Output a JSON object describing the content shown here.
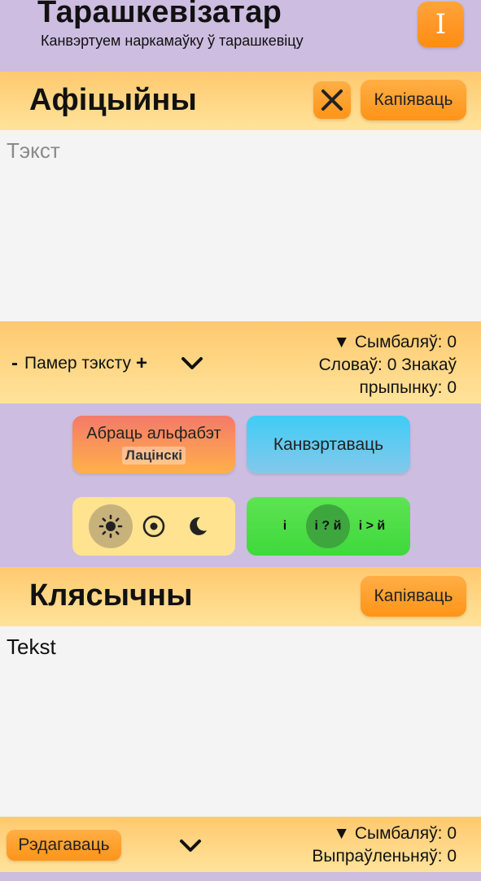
{
  "header": {
    "title": "Тарашкевізатар",
    "subtitle": "Канвэртуем наркамаўку ў тарашкевіцу",
    "info_label": "I"
  },
  "input_section": {
    "title": "Афіцыйны",
    "clear_icon": "close-icon",
    "copy_label": "Капіяваць",
    "text": "Тэкст",
    "font_size_minus": "-",
    "font_size_label": "Памер тэксту",
    "font_size_plus": "+",
    "expand_icon": "chevron-down-icon",
    "stats": {
      "symbols": "▼ Сымбаляў: 0",
      "words_punct_1": "Словаў: 0 Знакаў",
      "words_punct_2": "прыпынку: 0"
    }
  },
  "controls": {
    "alphabet_label": "Абраць альфабэт",
    "alphabet_value": "Лацінскі",
    "convert_label": "Канвэртаваць",
    "theme_options": [
      "light",
      "auto",
      "dark"
    ],
    "theme_selected": "light",
    "i_options": [
      "і",
      "і ? й",
      "і > й"
    ],
    "i_selected": "і ? й"
  },
  "output_section": {
    "title": "Клясычны",
    "copy_label": "Капіяваць",
    "text": "Tekst",
    "edit_label": "Рэдагаваць",
    "expand_icon": "chevron-down-icon",
    "stats": {
      "symbols": "▼ Сымбаляў: 0",
      "fixed": "Выпраўленьняў: 0"
    }
  },
  "colors": {
    "background": "#cdbde0",
    "band": "#ffd27e",
    "orange": "#ff9418",
    "blue": "#3fcdf6",
    "green": "#3fd93b"
  }
}
